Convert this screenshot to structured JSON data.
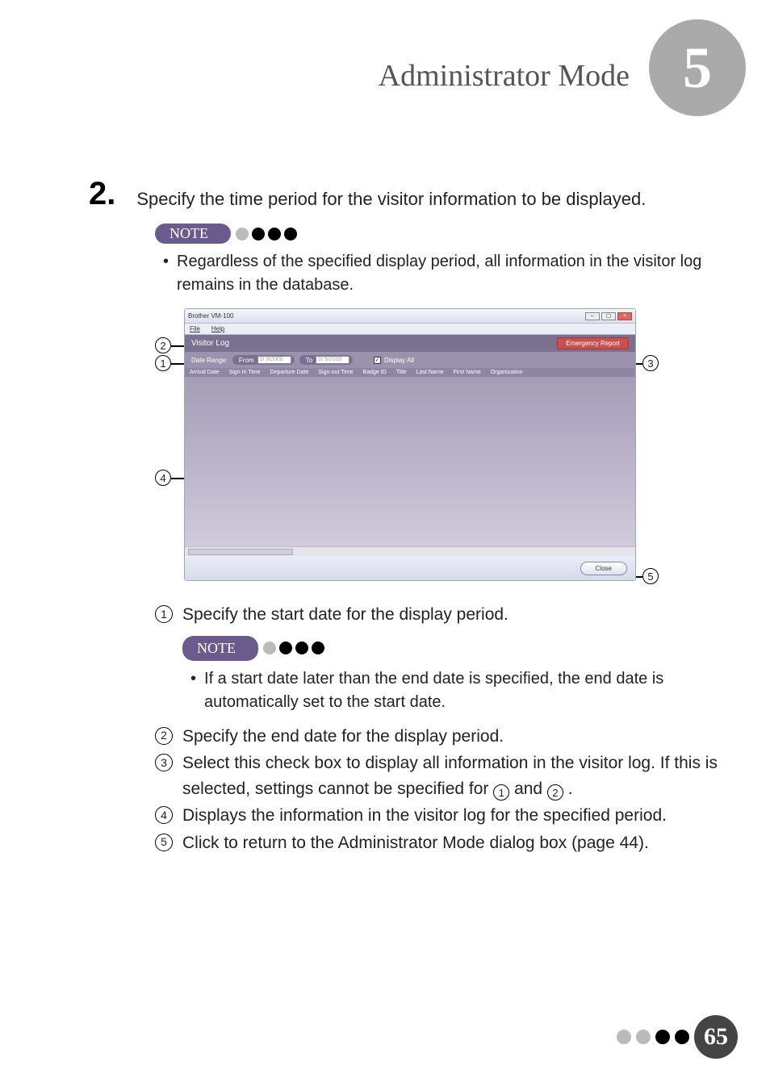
{
  "header": {
    "title": "Administrator Mode",
    "chapter": "5"
  },
  "step": {
    "number": "2.",
    "text": "Specify the time period for the visitor information to be displayed."
  },
  "note1": {
    "label": "NOTE",
    "bullet": "Regardless of the specified display period, all information in the visitor log remains in the database."
  },
  "screenshot": {
    "window_title": "Brother VM-100",
    "menu_file": "File",
    "menu_help": "Help",
    "panel_title": "Visitor Log",
    "emergency_button": "Emergency Report",
    "date_range_label": "Date Range:",
    "from_label": "From",
    "from_value": "9/ 9/2008",
    "to_label": "To",
    "to_value": "9/ 9/2008",
    "display_all_label": "Display All",
    "columns": [
      "Arrival Date",
      "Sign In Time",
      "Departure Date",
      "Sign-out Time",
      "Badge ID",
      "Title",
      "Last Name",
      "First Name",
      "Organization"
    ],
    "close_button": "Close"
  },
  "callouts": {
    "c1": "1",
    "c2": "2",
    "c3": "3",
    "c4": "4",
    "c5": "5"
  },
  "expl": {
    "item1": "Specify the start date for the display period.",
    "note2_label": "NOTE",
    "note2_bullet": "If a start date later than the end date is specified, the end date is automatically set to the start date.",
    "item2": "Specify the end date for the display period.",
    "item3_a": "Select this check box to display all information in the visitor log. If this is selected, settings cannot be specified for ",
    "item3_b": " and ",
    "item3_c": ".",
    "item4": "Displays the information in the visitor log for the specified period.",
    "item5": "Click to return to the Administrator Mode dialog box (page 44)."
  },
  "page_number": "65"
}
